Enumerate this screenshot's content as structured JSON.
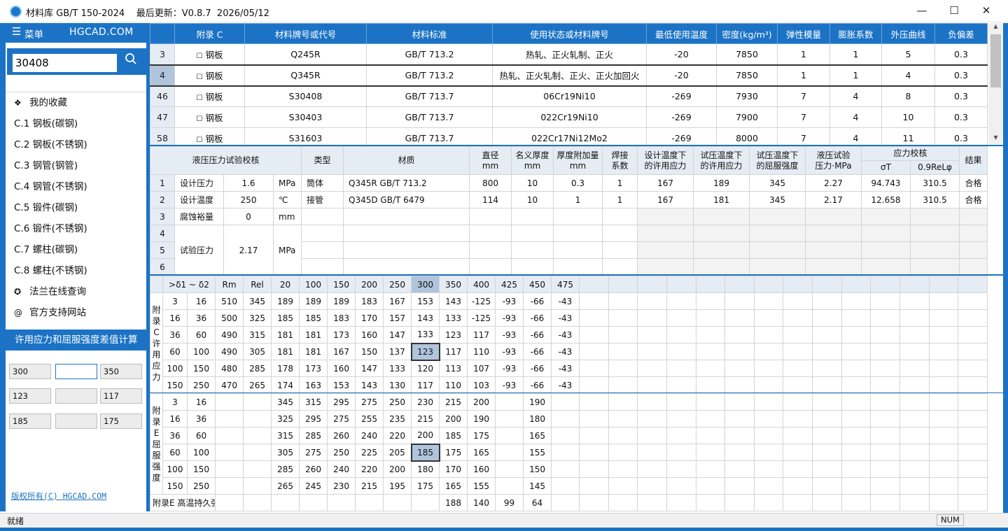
{
  "window": {
    "title": "材料库 GB/T 150-2024    最后更新：V0.8.7  2026/05/12",
    "min_symbol": "—",
    "max_symbol": "☐",
    "close_symbol": "✕"
  },
  "sidebar": {
    "menu_icon": "☰",
    "menu_label": "菜单",
    "brand": "HGCAD.COM",
    "search_value": "30408",
    "search_icon_glyph": "⚲",
    "items": [
      {
        "sym": "❖",
        "label": "我的收藏"
      },
      {
        "sym": "",
        "label": "C.1 钢板(碳钢)"
      },
      {
        "sym": "",
        "label": "C.2 钢板(不锈钢)"
      },
      {
        "sym": "",
        "label": "C.3 钢管(钢管)"
      },
      {
        "sym": "",
        "label": "C.4 钢管(不锈钢)"
      },
      {
        "sym": "",
        "label": "C.5 锻件(碳钢)"
      },
      {
        "sym": "",
        "label": "C.6 锻件(不锈钢)"
      },
      {
        "sym": "",
        "label": "C.7 螺柱(碳钢)"
      },
      {
        "sym": "",
        "label": "C.8 螺柱(不锈钢)"
      },
      {
        "sym": "✪",
        "label": "法兰在线查询"
      },
      {
        "sym": "@",
        "label": "官方支持网站"
      }
    ],
    "calc_title": "许用应力和屈服强度差值计算",
    "calc_values": [
      "300",
      "",
      "350",
      "123",
      "",
      "117",
      "185",
      "",
      "175"
    ],
    "copyright": "版权所有(C) HGCAD.COM"
  },
  "materials": {
    "headers": [
      "",
      "附录 C",
      "材料牌号或代号",
      "材料标准",
      "使用状态或材料牌号",
      "最低使用温度",
      "密度(kg/m³)",
      "弹性模量",
      "膨胀系数",
      "外压曲线",
      "负偏差"
    ],
    "checkbox_glyph": "☐",
    "rows": [
      [
        "3",
        "钢板",
        "Q245R",
        "GB/T 713.2",
        "热轧、正火轧制、正火",
        "-20",
        "7850",
        "1",
        "1",
        "5",
        "0.3"
      ],
      [
        "4",
        "钢板",
        "Q345R",
        "GB/T 713.2",
        "热轧、正火轧制、正火、正火加回火",
        "-20",
        "7850",
        "1",
        "1",
        "4",
        "0.3"
      ],
      [
        "46",
        "钢板",
        "S30408",
        "GB/T 713.7",
        "06Cr19Ni10",
        "-269",
        "7930",
        "7",
        "4",
        "8",
        "0.3"
      ],
      [
        "47",
        "钢板",
        "S30403",
        "GB/T 713.7",
        "022Cr19Ni10",
        "-269",
        "7900",
        "7",
        "4",
        "10",
        "0.3"
      ],
      [
        "58",
        "钢板",
        "S31603",
        "GB/T 713.7",
        "022Cr17Ni12Mo2",
        "-269",
        "8000",
        "7",
        "4",
        "11",
        "0.3"
      ]
    ]
  },
  "hydro": {
    "title": "液压压力试验校核",
    "headers": {
      "type": "类型",
      "material": "材质",
      "diameter": "直径\nmm",
      "nominal": "名义厚度\nmm",
      "allowance": "厚度附加量\nmm",
      "weld": "焊接\n系数",
      "design_stress": "设计温度下\n的许用应力",
      "test_stress": "试压温度下\n的许用应力",
      "test_yield": "试压温度下\n的屈服强度",
      "test_pressure": "液压试验\n压力·MPa",
      "stress_check": "应力校核",
      "sigma": "σT",
      "relphi": "0.9ReLφ",
      "result": "结果"
    },
    "params": [
      {
        "label": "设计压力",
        "value": "1.6",
        "unit": "MPa"
      },
      {
        "label": "设计温度",
        "value": "250",
        "unit": "℃"
      },
      {
        "label": "腐蚀裕量",
        "value": "0",
        "unit": "mm"
      },
      {
        "label": "试验压力",
        "value": "2.17",
        "unit": "MPa"
      }
    ],
    "row_numbers": [
      "1",
      "2",
      "3",
      "4",
      "5",
      "6"
    ],
    "rows": [
      [
        "筒体",
        "Q345R GB/T 713.2",
        "800",
        "10",
        "0.3",
        "1",
        "167",
        "189",
        "345",
        "2.27",
        "94.743",
        "310.5",
        "合格"
      ],
      [
        "接管",
        "Q345D GB/T 6479",
        "114",
        "10",
        "1",
        "1",
        "167",
        "181",
        "345",
        "2.17",
        "12.658",
        "310.5",
        "合格"
      ]
    ]
  },
  "stress": {
    "headers": [
      ">δ1 ~ δ2",
      "Rm",
      "Rel",
      "20",
      "100",
      "150",
      "200",
      "250",
      "300",
      "350",
      "400",
      "425",
      "450",
      "475"
    ],
    "label_c": "附录C 许用应力",
    "label_e": "附录E 屈服强度",
    "rows_c": [
      [
        "3",
        "16",
        "510",
        "345",
        "189",
        "189",
        "189",
        "183",
        "167",
        "153",
        "143",
        "-125",
        "-93",
        "-66",
        "-43"
      ],
      [
        "16",
        "36",
        "500",
        "325",
        "185",
        "185",
        "183",
        "170",
        "157",
        "143",
        "133",
        "-125",
        "-93",
        "-66",
        "-43"
      ],
      [
        "36",
        "60",
        "490",
        "315",
        "181",
        "181",
        "173",
        "160",
        "147",
        "133",
        "123",
        "117",
        "-93",
        "-66",
        "-43"
      ],
      [
        "60",
        "100",
        "490",
        "305",
        "181",
        "181",
        "167",
        "150",
        "137",
        "123",
        "117",
        "110",
        "-93",
        "-66",
        "-43"
      ],
      [
        "100",
        "150",
        "480",
        "285",
        "178",
        "173",
        "160",
        "147",
        "133",
        "120",
        "113",
        "107",
        "-93",
        "-66",
        "-43"
      ],
      [
        "150",
        "250",
        "470",
        "265",
        "174",
        "163",
        "153",
        "143",
        "130",
        "117",
        "110",
        "103",
        "-93",
        "-66",
        "-43"
      ]
    ],
    "rows_e": [
      [
        "3",
        "16",
        "",
        "",
        "345",
        "315",
        "295",
        "275",
        "250",
        "230",
        "215",
        "200",
        "",
        "190",
        ""
      ],
      [
        "16",
        "36",
        "",
        "",
        "325",
        "295",
        "275",
        "255",
        "235",
        "215",
        "200",
        "190",
        "",
        "180",
        ""
      ],
      [
        "36",
        "60",
        "",
        "",
        "315",
        "285",
        "260",
        "240",
        "220",
        "200",
        "185",
        "175",
        "",
        "165",
        ""
      ],
      [
        "60",
        "100",
        "",
        "",
        "305",
        "275",
        "250",
        "225",
        "205",
        "185",
        "175",
        "165",
        "",
        "155",
        ""
      ],
      [
        "100",
        "150",
        "",
        "",
        "285",
        "260",
        "240",
        "220",
        "200",
        "180",
        "170",
        "160",
        "",
        "150",
        ""
      ],
      [
        "150",
        "250",
        "",
        "",
        "265",
        "245",
        "230",
        "215",
        "195",
        "175",
        "165",
        "155",
        "",
        "145",
        ""
      ]
    ],
    "longterm_label": "附录E 高温持久强度",
    "longterm": [
      "188",
      "140",
      "99",
      "64"
    ]
  },
  "status": {
    "text": "就绪",
    "num": "NUM"
  }
}
